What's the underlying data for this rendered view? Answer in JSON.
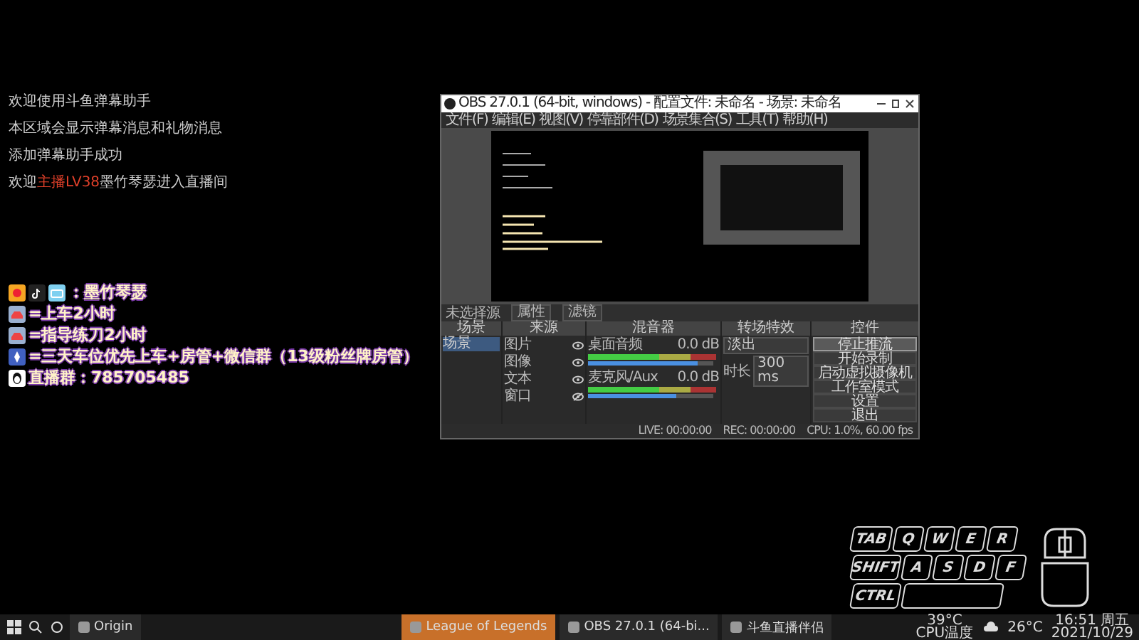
{
  "messages": [
    {
      "segments": [
        {
          "text": "欢迎使用斗鱼弹幕助手",
          "highlight": false
        }
      ]
    },
    {
      "segments": [
        {
          "text": "本区域会显示弹幕消息和礼物消息",
          "highlight": false
        }
      ]
    },
    {
      "segments": [
        {
          "text": "添加弹幕助手成功",
          "highlight": false
        }
      ]
    },
    {
      "segments": [
        {
          "text": "欢迎",
          "highlight": false
        },
        {
          "text": "主播",
          "highlight": true
        },
        {
          "text": "LV38",
          "highlight": true
        },
        {
          "text": "墨竹琴瑟进入直播间",
          "highlight": false
        }
      ]
    }
  ],
  "overlay": [
    {
      "kind": "platforms",
      "text": "：墨竹琴瑟"
    },
    {
      "kind": "car",
      "text": "=上车2小时"
    },
    {
      "kind": "car",
      "text": "=指导练刀2小时"
    },
    {
      "kind": "rocket",
      "text": "=三天车位优先上车+房管+微信群（13级粉丝牌房管）"
    },
    {
      "kind": "chat",
      "text": "直播群：785705485"
    }
  ],
  "obs": {
    "title": "OBS 27.0.1 (64-bit, windows) - 配置文件: 未命名 - 场景: 未命名",
    "menu": [
      "文件(F)",
      "编辑(E)",
      "视图(V)",
      "停靠部件(D)",
      "场景集合(S)",
      "工具(T)",
      "帮助(H)"
    ],
    "source_status": "未选择源",
    "source_buttons": [
      "属性",
      "滤镜"
    ],
    "scenes": {
      "title": "场景",
      "items": [
        {
          "label": "场景",
          "selected": true
        }
      ]
    },
    "sources": {
      "title": "来源",
      "items": [
        {
          "label": "图片",
          "visible": true
        },
        {
          "label": "图像",
          "visible": true
        },
        {
          "label": "文本",
          "visible": true
        },
        {
          "label": "窗口",
          "visible": false
        }
      ]
    },
    "mixer": {
      "title": "混音器",
      "channels": [
        {
          "name": "桌面音频",
          "reading": "0.0 dB",
          "level": 0.88
        },
        {
          "name": "麦克风/Aux",
          "reading": "0.0 dB",
          "level": 0.7
        }
      ]
    },
    "transitions": {
      "title": "转场特效",
      "type": "淡出",
      "duration_label": "时长",
      "duration": "300 ms"
    },
    "controls": {
      "title": "控件",
      "buttons": [
        {
          "label": "停止推流",
          "selected": true
        },
        {
          "label": "开始录制",
          "selected": false
        },
        {
          "label": "启动虚拟摄像机",
          "selected": false
        },
        {
          "label": "工作室模式",
          "selected": false
        },
        {
          "label": "设置",
          "selected": false
        },
        {
          "label": "退出",
          "selected": false
        }
      ]
    },
    "status": [
      "LIVE: 00:00:00",
      "REC: 00:00:00",
      "CPU: 1.0%, 60.00 fps"
    ]
  },
  "keyboard": {
    "rows": [
      [
        "TAB",
        "Q",
        "W",
        "E",
        "R"
      ],
      [
        "SHIFT",
        "A",
        "S",
        "D",
        "F"
      ],
      [
        "CTRL"
      ]
    ]
  },
  "taskbar": {
    "items": [
      {
        "label": "Origin",
        "selected": false
      },
      {
        "label": "League of Legends",
        "selected": true
      },
      {
        "label": "OBS 27.0.1 (64-bi...",
        "selected": false
      },
      {
        "label": "斗鱼直播伴侣",
        "selected": false
      }
    ],
    "cpu_temp": "39°C",
    "cpu_label": "CPU温度",
    "weather": "26°C",
    "time": "16:51 周五",
    "date": "2021/10/29"
  }
}
